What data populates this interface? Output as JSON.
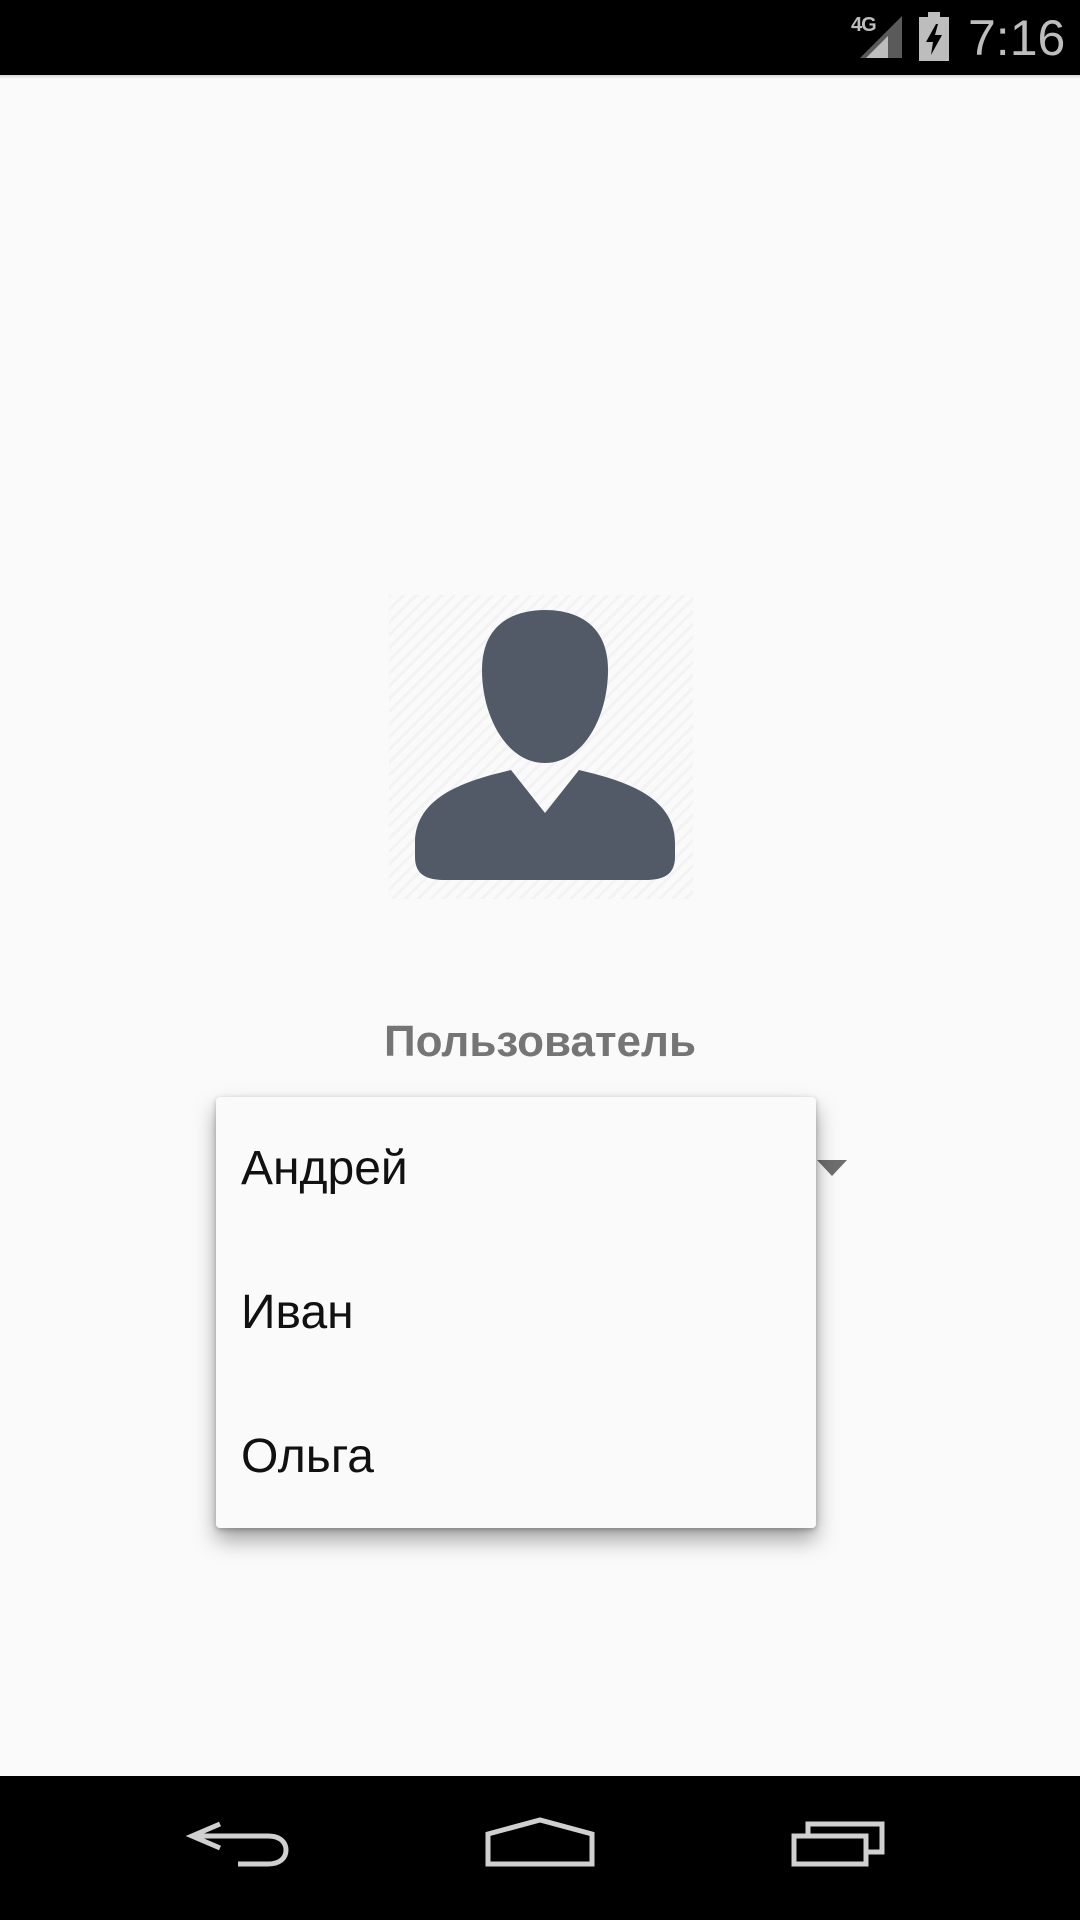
{
  "status_bar": {
    "network_type": "4G",
    "time": "7:16",
    "icons": [
      "signal-icon",
      "battery-charging-icon"
    ]
  },
  "avatar": {
    "icon": "user-silhouette-icon",
    "color": "#525a68"
  },
  "main": {
    "label": "Пользователь"
  },
  "spinner": {
    "open": true,
    "options": [
      {
        "label": "Андрей"
      },
      {
        "label": "Иван"
      },
      {
        "label": "Ольга"
      }
    ]
  },
  "nav_bar": {
    "buttons": [
      "back-icon",
      "home-icon",
      "recents-icon"
    ]
  }
}
